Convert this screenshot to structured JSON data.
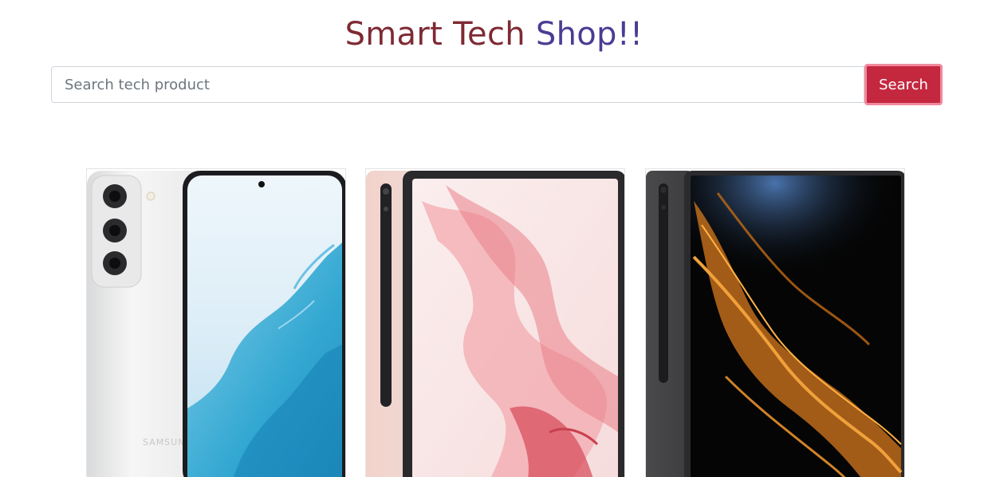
{
  "header": {
    "title_part1": "Smart Tech ",
    "title_part2": "Shop!!",
    "title_color1": "#7e2a33",
    "title_color2": "#4a3d93"
  },
  "search": {
    "placeholder": "Search tech product",
    "value": "",
    "button_label": "Search",
    "button_color": "#c4283f"
  },
  "products": [
    {
      "image": "phone-white",
      "brand_mark": "SAMSUNG"
    },
    {
      "image": "tablet-pink"
    },
    {
      "image": "tablet-graphite"
    }
  ]
}
